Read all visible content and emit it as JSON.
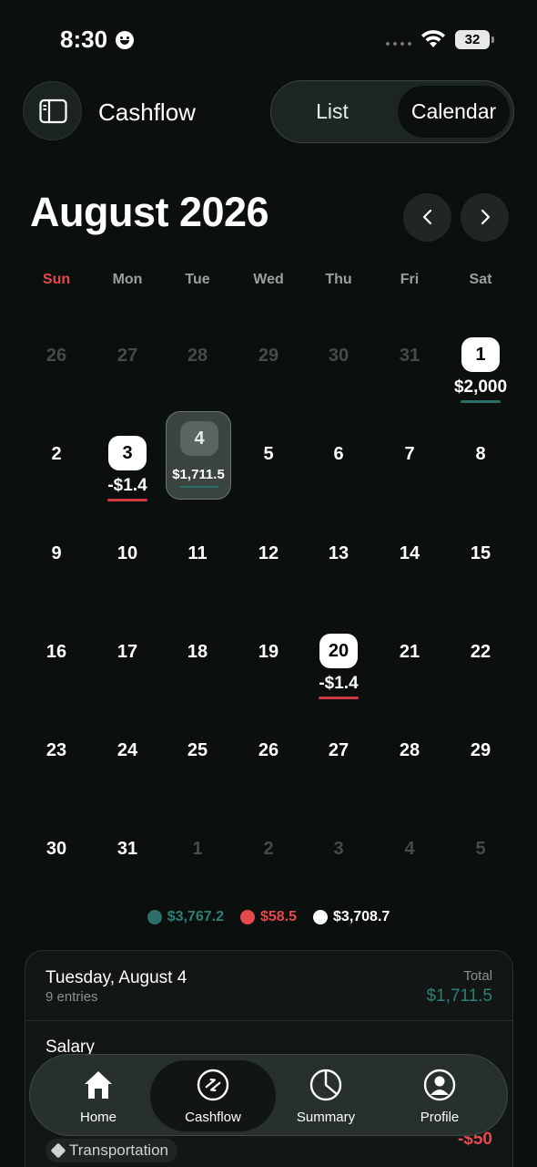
{
  "status_bar": {
    "time": "8:30",
    "battery": "32"
  },
  "header": {
    "title": "Cashflow",
    "segment": {
      "list": "List",
      "calendar": "Calendar"
    }
  },
  "calendar": {
    "month_title": "August 2026",
    "weekdays": [
      "Sun",
      "Mon",
      "Tue",
      "Wed",
      "Thu",
      "Fri",
      "Sat"
    ],
    "weeks": [
      [
        {
          "d": "26",
          "muted": true
        },
        {
          "d": "27",
          "muted": true
        },
        {
          "d": "28",
          "muted": true
        },
        {
          "d": "29",
          "muted": true
        },
        {
          "d": "30",
          "muted": true
        },
        {
          "d": "31",
          "muted": true
        },
        {
          "d": "1",
          "amount": "$2,000",
          "bar": "green"
        }
      ],
      [
        {
          "d": "2"
        },
        {
          "d": "3",
          "amount": "-$1.4",
          "bar": "red"
        },
        {
          "d": "4",
          "amount": "$1,711.5",
          "bar": "green",
          "selected": true
        },
        {
          "d": "5"
        },
        {
          "d": "6"
        },
        {
          "d": "7"
        },
        {
          "d": "8"
        }
      ],
      [
        {
          "d": "9"
        },
        {
          "d": "10"
        },
        {
          "d": "11"
        },
        {
          "d": "12"
        },
        {
          "d": "13"
        },
        {
          "d": "14"
        },
        {
          "d": "15"
        }
      ],
      [
        {
          "d": "16"
        },
        {
          "d": "17"
        },
        {
          "d": "18"
        },
        {
          "d": "19"
        },
        {
          "d": "20",
          "amount": "-$1.4",
          "bar": "red"
        },
        {
          "d": "21"
        },
        {
          "d": "22"
        }
      ],
      [
        {
          "d": "23"
        },
        {
          "d": "24"
        },
        {
          "d": "25"
        },
        {
          "d": "26"
        },
        {
          "d": "27"
        },
        {
          "d": "28"
        },
        {
          "d": "29"
        }
      ],
      [
        {
          "d": "30"
        },
        {
          "d": "31"
        },
        {
          "d": "1",
          "muted": true
        },
        {
          "d": "2",
          "muted": true
        },
        {
          "d": "3",
          "muted": true
        },
        {
          "d": "4",
          "muted": true
        },
        {
          "d": "5",
          "muted": true
        }
      ]
    ]
  },
  "totals": {
    "income": "$3,767.2",
    "expense": "$58.5",
    "net": "$3,708.7"
  },
  "entries_card": {
    "date": "Tuesday, August 4",
    "count": "9 entries",
    "total_label": "Total",
    "total_value": "$1,711.5",
    "first_entry": "Salary",
    "second_amount": "-$50",
    "category": "Transportation"
  },
  "tabbar": {
    "home": "Home",
    "cashflow": "Cashflow",
    "summary": "Summary",
    "profile": "Profile"
  },
  "colors": {
    "income": "#2f7f77",
    "expense": "#e5484d",
    "background": "#0b0f0d"
  }
}
